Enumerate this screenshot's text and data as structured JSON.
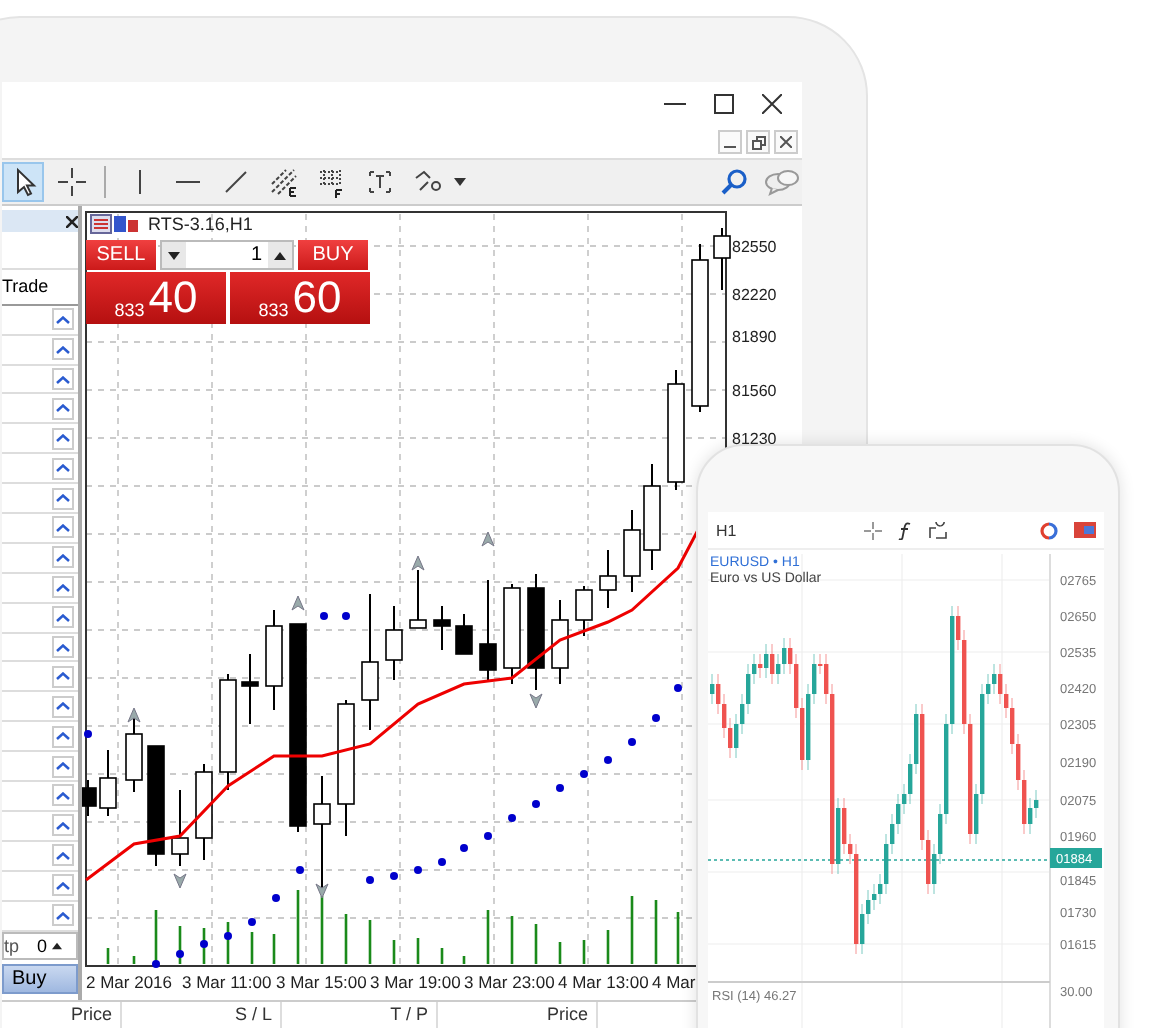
{
  "toolbar": {
    "tools": [
      {
        "kind": "cursor",
        "selected": true
      },
      {
        "kind": "crosshair",
        "selected": false
      },
      {
        "kind": "vertical-line",
        "selected": false
      },
      {
        "kind": "horizontal-line",
        "selected": false
      },
      {
        "kind": "trend-line",
        "selected": false
      },
      {
        "kind": "fibonacci",
        "selected": false
      },
      {
        "kind": "grid",
        "selected": false
      },
      {
        "kind": "text",
        "selected": false
      },
      {
        "kind": "shapes",
        "selected": false
      }
    ]
  },
  "panel": {
    "header": "Trade",
    "order_field": {
      "label": "tp",
      "value": "0"
    },
    "buy_button": "Buy"
  },
  "chart": {
    "symbol": "RTS-3.16,H1",
    "sell_label": "SELL",
    "buy_label": "BUY",
    "volume": "1",
    "bid": {
      "prefix": "833",
      "pips": "40"
    },
    "ask": {
      "prefix": "833",
      "pips": "60"
    },
    "price_axis": [
      "82550",
      "82220",
      "81890",
      "81560",
      "81230"
    ],
    "time_axis": [
      "2 Mar 2016",
      "3 Mar 11:00",
      "3 Mar 15:00",
      "3 Mar 19:00",
      "3 Mar 23:00",
      "4 Mar 13:00",
      "4 Mar"
    ]
  },
  "bottom_columns": [
    "Price",
    "S / L",
    "T / P",
    "Price"
  ],
  "phone": {
    "timeframe": "H1",
    "symbol": "EURUSD • H1",
    "description": "Euro vs US Dollar",
    "price_axis": [
      "02765",
      "02650",
      "02535",
      "02420",
      "02305",
      "02190",
      "02075",
      "01960",
      "01845",
      "01730",
      "01615"
    ],
    "current_price": "01884",
    "indicator": "RSI (14) 46.27",
    "indicator_axis": "30.00"
  }
}
